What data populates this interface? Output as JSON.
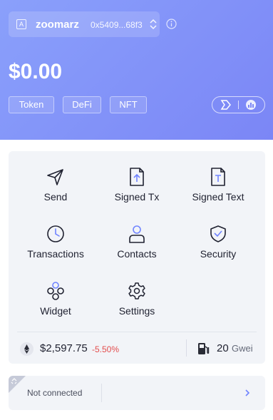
{
  "account": {
    "icon_letter": "A",
    "name": "zoomarz",
    "address": "0x5409...68f3"
  },
  "balance": "$0.00",
  "tabs": [
    "Token",
    "DeFi",
    "NFT"
  ],
  "actions": [
    {
      "label": "Send",
      "icon": "send-icon"
    },
    {
      "label": "Signed Tx",
      "icon": "signed-tx-icon"
    },
    {
      "label": "Signed Text",
      "icon": "signed-text-icon"
    },
    {
      "label": "Transactions",
      "icon": "clock-icon"
    },
    {
      "label": "Contacts",
      "icon": "contacts-icon"
    },
    {
      "label": "Security",
      "icon": "shield-check-icon"
    },
    {
      "label": "Widget",
      "icon": "widget-icon"
    },
    {
      "label": "Settings",
      "icon": "settings-gear-icon"
    }
  ],
  "market": {
    "eth_price": "$2,597.75",
    "eth_change": "-5.50%",
    "gas_value": "20",
    "gas_unit": "Gwei"
  },
  "connection": {
    "status": "Not connected"
  },
  "colors": {
    "header_start": "#8aa0fb",
    "header_end": "#7b86f6",
    "accent": "#7084ff",
    "negative": "#e34d4d"
  }
}
